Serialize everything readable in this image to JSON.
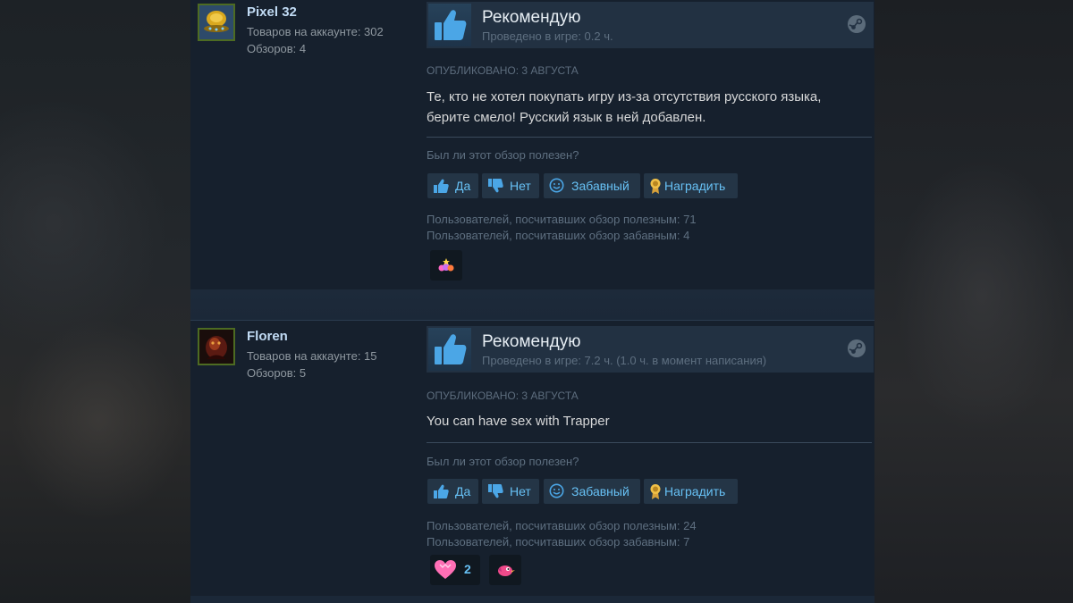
{
  "reviews": [
    {
      "username": "Pixel 32",
      "products": "Товаров на аккаунте: 302",
      "reviews_count": "Обзоров: 4",
      "verdict": "Рекомендую",
      "hours": "Проведено в игре: 0.2 ч.",
      "posted": "ОПУБЛИКОВАНО: 3 АВГУСТА",
      "text_line1": "Те, кто не хотел покупать игру из-за отсутствия русского языка,",
      "text_line2": "берите смело! Русский язык в ней добавлен.",
      "helpful_question": "Был ли этот обзор полезен?",
      "btn_yes": "Да",
      "btn_no": "Нет",
      "btn_funny": "Забавный",
      "btn_award": "Наградить",
      "helpful_stat": "Пользователей, посчитавших обзор полезным: 71",
      "funny_stat": "Пользователей, посчитавших обзор забавным: 4"
    },
    {
      "username": "Floren",
      "products": "Товаров на аккаунте: 15",
      "reviews_count": "Обзоров: 5",
      "verdict": "Рекомендую",
      "hours": "Проведено в игре: 7.2 ч. (1.0 ч. в момент написания)",
      "posted": "ОПУБЛИКОВАНО: 3 АВГУСТА",
      "text_line1": "You can have sex with Trapper",
      "helpful_question": "Был ли этот обзор полезен?",
      "btn_yes": "Да",
      "btn_no": "Нет",
      "btn_funny": "Забавный",
      "btn_award": "Наградить",
      "helpful_stat": "Пользователей, посчитавших обзор полезным: 24",
      "funny_stat": "Пользователей, посчитавших обзор забавным: 7",
      "award_count": "2"
    }
  ],
  "icons": {
    "thumb": "thumbs-up-icon",
    "steam": "steam-logo-icon",
    "yes": "thumb-up-small-icon",
    "no": "thumb-down-small-icon",
    "funny": "smiley-icon",
    "award": "award-ribbon-icon"
  },
  "colors": {
    "link": "#67c1f5",
    "review_bg": "#16202d",
    "header_bg": "#223142",
    "thumb_blue": "#4ba6e6",
    "avatar_border": "#4d6b22"
  }
}
